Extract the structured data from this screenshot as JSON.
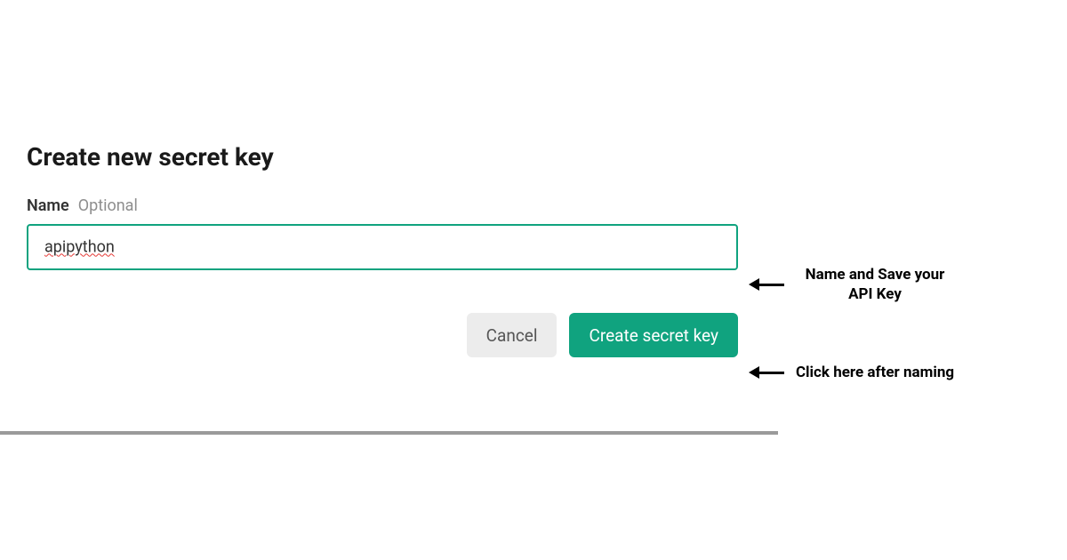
{
  "dialog": {
    "title": "Create new secret key",
    "field": {
      "label": "Name",
      "hint": "Optional",
      "value": "apipython"
    },
    "buttons": {
      "cancel": "Cancel",
      "create": "Create secret key"
    }
  },
  "annotations": {
    "input": "Name and Save your API Key",
    "button": "Click here after naming"
  }
}
